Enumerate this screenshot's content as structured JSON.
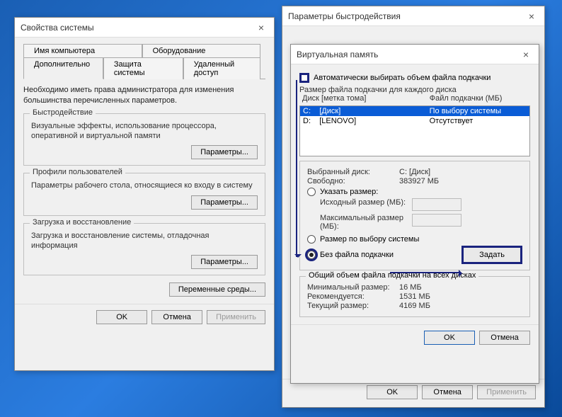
{
  "sysprops": {
    "title": "Свойства системы",
    "tabs": {
      "computer_name": "Имя компьютера",
      "hardware": "Оборудование",
      "advanced": "Дополнительно",
      "system_protection": "Защита системы",
      "remote": "Удаленный доступ"
    },
    "adv_desc": "Необходимо иметь права администратора для изменения большинства перечисленных параметров.",
    "perf": {
      "legend": "Быстродействие",
      "text": "Визуальные эффекты, использование процессора, оперативной и виртуальной памяти",
      "btn": "Параметры..."
    },
    "profiles": {
      "legend": "Профили пользователей",
      "text": "Параметры рабочего стола, относящиеся ко входу в систему",
      "btn": "Параметры..."
    },
    "startup": {
      "legend": "Загрузка и восстановление",
      "text": "Загрузка и восстановление системы, отладочная информация",
      "btn": "Параметры..."
    },
    "env_btn": "Переменные среды...",
    "ok": "OK",
    "cancel": "Отмена",
    "apply": "Применить"
  },
  "perfopts": {
    "title": "Параметры быстродействия",
    "ok": "OK",
    "cancel": "Отмена",
    "apply": "Применить"
  },
  "vmem": {
    "title": "Виртуальная память",
    "auto_chk": "Автоматически выбирать объем файла подкачки",
    "per_drive_label": "Размер файла подкачки для каждого диска",
    "col_drive": "Диск [метка тома]",
    "col_file": "Файл подкачки (МБ)",
    "rows": [
      {
        "drv": "C:",
        "label": "[Диск]",
        "val": "По выбору системы"
      },
      {
        "drv": "D:",
        "label": "[LENOVO]",
        "val": "Отсутствует"
      }
    ],
    "selected_drive_label": "Выбранный диск:",
    "selected_drive_val": "C: [Диск]",
    "free_label": "Свободно:",
    "free_val": "383927 МБ",
    "radio_custom": "Указать размер:",
    "init_size": "Исходный размер (МБ):",
    "max_size": "Максимальный размер (МБ):",
    "radio_system": "Размер по выбору системы",
    "radio_none": "Без файла подкачки",
    "set_btn": "Задать",
    "total_legend": "Общий объем файла подкачки на всех дисках",
    "min_label": "Минимальный размер:",
    "min_val": "16 МБ",
    "rec_label": "Рекомендуется:",
    "rec_val": "1531 МБ",
    "cur_label": "Текущий размер:",
    "cur_val": "4169 МБ",
    "ok": "OK",
    "cancel": "Отмена"
  }
}
